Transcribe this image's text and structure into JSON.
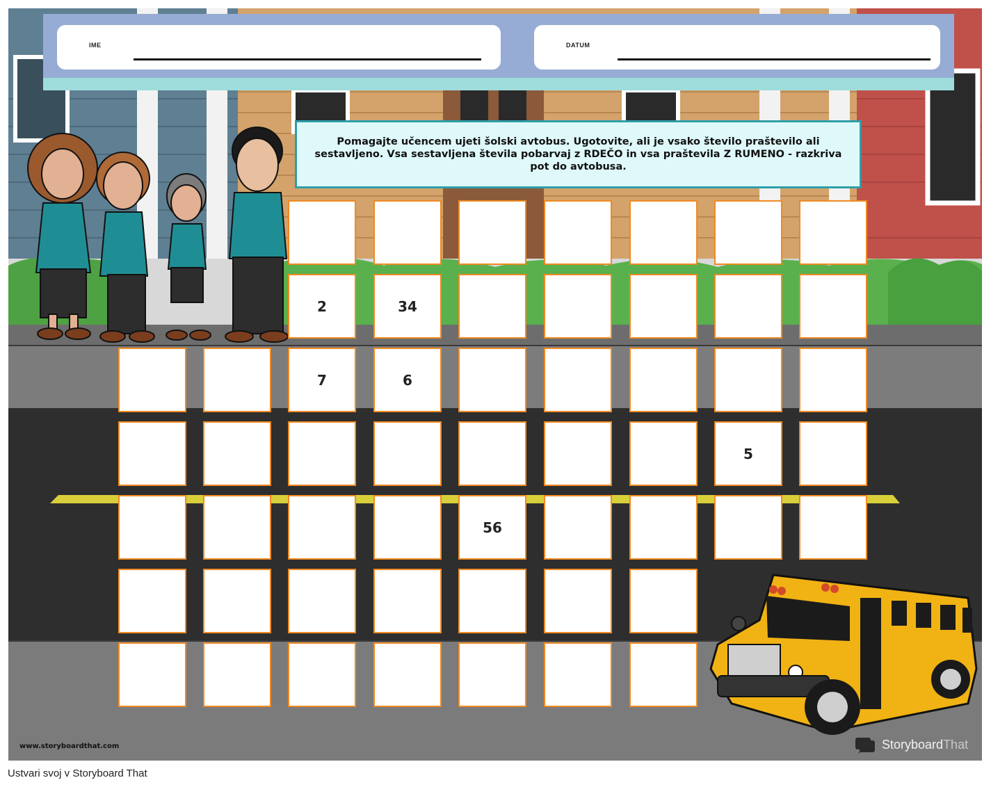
{
  "header": {
    "name_label": "IME",
    "date_label": "DATUM"
  },
  "instructions": "Pomagajte učencem ujeti šolski avtobus. Ugotovite, ali je vsako število praštevilo ali sestavljeno. Vsa sestavljena števila pobarvaj z RDEČO in vsa praštevila Z RUMENO - razkriva pot do avtobusa.",
  "grid": {
    "rows": [
      [
        "",
        "",
        "",
        "",
        "",
        "",
        ""
      ],
      [
        "2",
        "34",
        "",
        "",
        "",
        "",
        ""
      ],
      [
        "",
        "",
        "7",
        "6",
        "",
        "",
        "",
        "",
        ""
      ],
      [
        "",
        "",
        "",
        "",
        "",
        "",
        "",
        "5",
        ""
      ],
      [
        "",
        "",
        "",
        "",
        "56",
        "",
        "",
        "",
        ""
      ],
      [
        "",
        "",
        "",
        "",
        "",
        "",
        ""
      ],
      [
        "",
        "",
        "",
        "",
        "",
        "",
        ""
      ]
    ]
  },
  "watermark": {
    "site": "www.storyboardthat.com",
    "brand_part1": "Storyboard",
    "brand_part2": "That"
  },
  "footer": {
    "credit": "Ustvari svoj v Storyboard That"
  }
}
